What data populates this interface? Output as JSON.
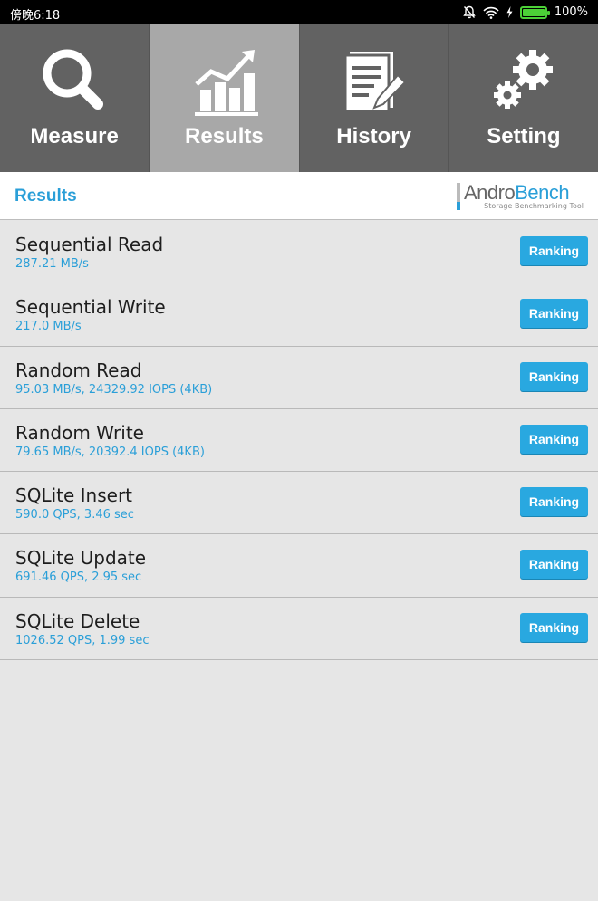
{
  "status": {
    "time": "傍晚6:18",
    "battery": "100%",
    "battery_level": 1.0
  },
  "tabs": [
    {
      "label": "Measure",
      "icon": "magnifier-icon",
      "active": false
    },
    {
      "label": "Results",
      "icon": "chart-icon",
      "active": true
    },
    {
      "label": "History",
      "icon": "document-edit-icon",
      "active": false
    },
    {
      "label": "Setting",
      "icon": "gears-icon",
      "active": false
    }
  ],
  "header": {
    "title": "Results",
    "logo_part1": "Andro",
    "logo_part2": "Bench",
    "logo_subtitle": "Storage Benchmarking Tool"
  },
  "results": [
    {
      "name": "Sequential Read",
      "value": "287.21 MB/s",
      "button": "Ranking"
    },
    {
      "name": "Sequential Write",
      "value": "217.0 MB/s",
      "button": "Ranking"
    },
    {
      "name": "Random Read",
      "value": "95.03 MB/s, 24329.92 IOPS (4KB)",
      "button": "Ranking"
    },
    {
      "name": "Random Write",
      "value": "79.65 MB/s, 20392.4 IOPS (4KB)",
      "button": "Ranking"
    },
    {
      "name": "SQLite Insert",
      "value": "590.0 QPS, 3.46 sec",
      "button": "Ranking"
    },
    {
      "name": "SQLite Update",
      "value": "691.46 QPS, 2.95 sec",
      "button": "Ranking"
    },
    {
      "name": "SQLite Delete",
      "value": "1026.52 QPS, 1.99 sec",
      "button": "Ranking"
    }
  ],
  "colors": {
    "accent": "#2a9fd8",
    "button": "#29a8e0",
    "tab_bg": "#626262",
    "tab_active_bg": "#a8a8a8"
  }
}
